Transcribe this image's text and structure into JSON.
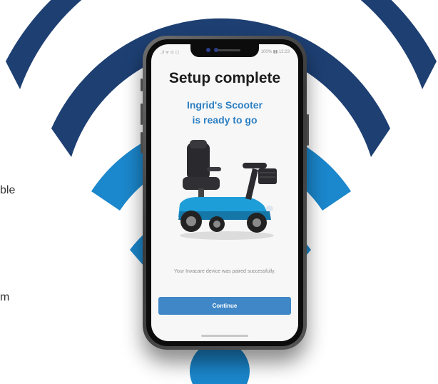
{
  "background": {
    "arc_outer_color": "#1d3f72",
    "arc_inner_color": "#1b87cc",
    "partial_text_1": "ble",
    "partial_text_2": "m"
  },
  "phone": {
    "status_left": "..ll ᯤ ⊙ ▢",
    "status_right": "100% ▮▮ 12:23",
    "screen": {
      "title": "Setup complete",
      "subtitle_line1": "Ingrid's Scooter",
      "subtitle_line2": "is ready to go",
      "message": "Your Invacare device was paired successfully.",
      "continue_label": "Continue",
      "accent_color": "#2c7fc2",
      "button_color": "#3f87c7"
    }
  }
}
